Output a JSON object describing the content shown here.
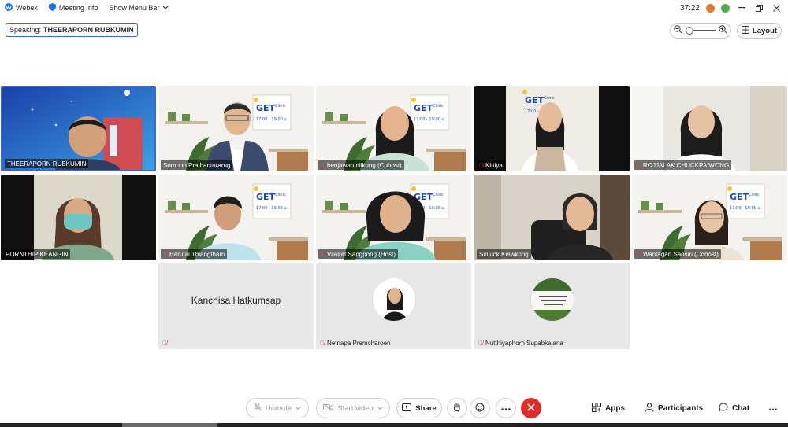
{
  "topbar": {
    "app_name": "Webex",
    "meeting_info": "Meeting Info",
    "show_menu_bar": "Show Menu Bar",
    "timer": "37:22",
    "colors": {
      "webex": "#1a73e8",
      "dot1": "#e07b2a",
      "dot2": "#5aa84e"
    }
  },
  "speaking": {
    "prefix": "Speaking:",
    "name": "THEERAPORN RUBKUMIN"
  },
  "layout_button": {
    "label": "Layout"
  },
  "participants": [
    {
      "name": "THEERAPORN RUBKUMIN",
      "muted": false
    },
    {
      "name": "Sompop Prathanturarug",
      "muted": false
    },
    {
      "name": "benjawan nilkong (Cohost)",
      "muted": true
    },
    {
      "name": "Kittiya",
      "muted": true
    },
    {
      "name": "ROJJALAK CHUCKPAIWONG",
      "muted": true
    },
    {
      "name": "PORNTHIP KEANGIN",
      "muted": false
    },
    {
      "name": "Harutai Thiangtham",
      "muted": true
    },
    {
      "name": "Vilairat Sangpong (Host)",
      "muted": true
    },
    {
      "name": "Siriluck Kiewkong",
      "muted": false
    },
    {
      "name": "Wantagan Saosiri (Cohost)",
      "muted": true
    }
  ],
  "no_video": [
    {
      "name": "Kanchisa Hatkumsap",
      "display": "Kanchisa Hatkumsap",
      "label": ""
    },
    {
      "name": "Netnapa Premcharoen",
      "label": "Netnapa Premcharoen"
    },
    {
      "name": "Nutthiyaphorn Supabkajana",
      "label": "Nutthiyaphorn Supabkajana"
    }
  ],
  "get_sign": {
    "brand": "GET",
    "sub": "Clinic",
    "time": "17:00 - 19:00 u."
  },
  "controls": {
    "unmute": "Unmute",
    "start_video": "Start video",
    "share": "Share",
    "apps": "Apps",
    "participants": "Participants",
    "chat": "Chat",
    "end_color": "#e02b2b"
  },
  "icons": [
    "webex-icon",
    "shield-icon",
    "chevron-down-icon",
    "minimize-icon",
    "restore-icon",
    "close-icon",
    "zoom-out-icon",
    "zoom-in-icon",
    "grid-icon",
    "mic-off-icon",
    "video-off-icon",
    "share-icon",
    "raise-hand-icon",
    "reactions-icon",
    "more-icon",
    "end-call-icon",
    "apps-icon",
    "participants-icon",
    "chat-icon"
  ]
}
